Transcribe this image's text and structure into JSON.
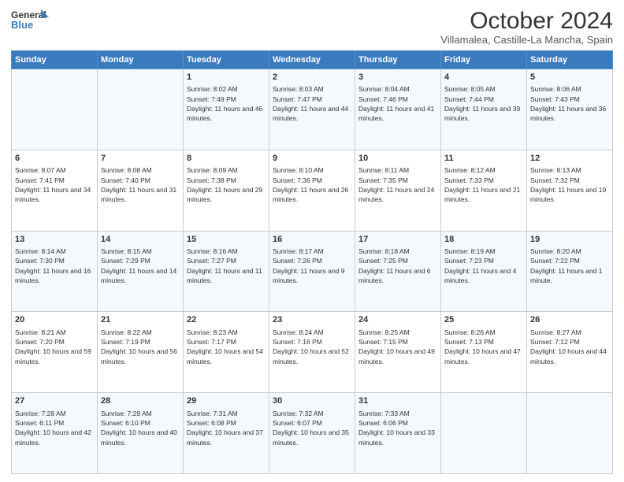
{
  "logo": {
    "line1": "General",
    "line2": "Blue"
  },
  "title": "October 2024",
  "subtitle": "Villamalea, Castille-La Mancha, Spain",
  "headers": [
    "Sunday",
    "Monday",
    "Tuesday",
    "Wednesday",
    "Thursday",
    "Friday",
    "Saturday"
  ],
  "weeks": [
    [
      {
        "day": "",
        "sunrise": "",
        "sunset": "",
        "daylight": ""
      },
      {
        "day": "",
        "sunrise": "",
        "sunset": "",
        "daylight": ""
      },
      {
        "day": "1",
        "sunrise": "Sunrise: 8:02 AM",
        "sunset": "Sunset: 7:49 PM",
        "daylight": "Daylight: 11 hours and 46 minutes."
      },
      {
        "day": "2",
        "sunrise": "Sunrise: 8:03 AM",
        "sunset": "Sunset: 7:47 PM",
        "daylight": "Daylight: 11 hours and 44 minutes."
      },
      {
        "day": "3",
        "sunrise": "Sunrise: 8:04 AM",
        "sunset": "Sunset: 7:46 PM",
        "daylight": "Daylight: 11 hours and 41 minutes."
      },
      {
        "day": "4",
        "sunrise": "Sunrise: 8:05 AM",
        "sunset": "Sunset: 7:44 PM",
        "daylight": "Daylight: 11 hours and 39 minutes."
      },
      {
        "day": "5",
        "sunrise": "Sunrise: 8:06 AM",
        "sunset": "Sunset: 7:43 PM",
        "daylight": "Daylight: 11 hours and 36 minutes."
      }
    ],
    [
      {
        "day": "6",
        "sunrise": "Sunrise: 8:07 AM",
        "sunset": "Sunset: 7:41 PM",
        "daylight": "Daylight: 11 hours and 34 minutes."
      },
      {
        "day": "7",
        "sunrise": "Sunrise: 8:08 AM",
        "sunset": "Sunset: 7:40 PM",
        "daylight": "Daylight: 11 hours and 31 minutes."
      },
      {
        "day": "8",
        "sunrise": "Sunrise: 8:09 AM",
        "sunset": "Sunset: 7:38 PM",
        "daylight": "Daylight: 11 hours and 29 minutes."
      },
      {
        "day": "9",
        "sunrise": "Sunrise: 8:10 AM",
        "sunset": "Sunset: 7:36 PM",
        "daylight": "Daylight: 11 hours and 26 minutes."
      },
      {
        "day": "10",
        "sunrise": "Sunrise: 8:11 AM",
        "sunset": "Sunset: 7:35 PM",
        "daylight": "Daylight: 11 hours and 24 minutes."
      },
      {
        "day": "11",
        "sunrise": "Sunrise: 8:12 AM",
        "sunset": "Sunset: 7:33 PM",
        "daylight": "Daylight: 11 hours and 21 minutes."
      },
      {
        "day": "12",
        "sunrise": "Sunrise: 8:13 AM",
        "sunset": "Sunset: 7:32 PM",
        "daylight": "Daylight: 11 hours and 19 minutes."
      }
    ],
    [
      {
        "day": "13",
        "sunrise": "Sunrise: 8:14 AM",
        "sunset": "Sunset: 7:30 PM",
        "daylight": "Daylight: 11 hours and 16 minutes."
      },
      {
        "day": "14",
        "sunrise": "Sunrise: 8:15 AM",
        "sunset": "Sunset: 7:29 PM",
        "daylight": "Daylight: 11 hours and 14 minutes."
      },
      {
        "day": "15",
        "sunrise": "Sunrise: 8:16 AM",
        "sunset": "Sunset: 7:27 PM",
        "daylight": "Daylight: 11 hours and 11 minutes."
      },
      {
        "day": "16",
        "sunrise": "Sunrise: 8:17 AM",
        "sunset": "Sunset: 7:26 PM",
        "daylight": "Daylight: 11 hours and 9 minutes."
      },
      {
        "day": "17",
        "sunrise": "Sunrise: 8:18 AM",
        "sunset": "Sunset: 7:25 PM",
        "daylight": "Daylight: 11 hours and 6 minutes."
      },
      {
        "day": "18",
        "sunrise": "Sunrise: 8:19 AM",
        "sunset": "Sunset: 7:23 PM",
        "daylight": "Daylight: 11 hours and 4 minutes."
      },
      {
        "day": "19",
        "sunrise": "Sunrise: 8:20 AM",
        "sunset": "Sunset: 7:22 PM",
        "daylight": "Daylight: 11 hours and 1 minute."
      }
    ],
    [
      {
        "day": "20",
        "sunrise": "Sunrise: 8:21 AM",
        "sunset": "Sunset: 7:20 PM",
        "daylight": "Daylight: 10 hours and 59 minutes."
      },
      {
        "day": "21",
        "sunrise": "Sunrise: 8:22 AM",
        "sunset": "Sunset: 7:19 PM",
        "daylight": "Daylight: 10 hours and 56 minutes."
      },
      {
        "day": "22",
        "sunrise": "Sunrise: 8:23 AM",
        "sunset": "Sunset: 7:17 PM",
        "daylight": "Daylight: 10 hours and 54 minutes."
      },
      {
        "day": "23",
        "sunrise": "Sunrise: 8:24 AM",
        "sunset": "Sunset: 7:16 PM",
        "daylight": "Daylight: 10 hours and 52 minutes."
      },
      {
        "day": "24",
        "sunrise": "Sunrise: 8:25 AM",
        "sunset": "Sunset: 7:15 PM",
        "daylight": "Daylight: 10 hours and 49 minutes."
      },
      {
        "day": "25",
        "sunrise": "Sunrise: 8:26 AM",
        "sunset": "Sunset: 7:13 PM",
        "daylight": "Daylight: 10 hours and 47 minutes."
      },
      {
        "day": "26",
        "sunrise": "Sunrise: 8:27 AM",
        "sunset": "Sunset: 7:12 PM",
        "daylight": "Daylight: 10 hours and 44 minutes."
      }
    ],
    [
      {
        "day": "27",
        "sunrise": "Sunrise: 7:28 AM",
        "sunset": "Sunset: 6:11 PM",
        "daylight": "Daylight: 10 hours and 42 minutes."
      },
      {
        "day": "28",
        "sunrise": "Sunrise: 7:29 AM",
        "sunset": "Sunset: 6:10 PM",
        "daylight": "Daylight: 10 hours and 40 minutes."
      },
      {
        "day": "29",
        "sunrise": "Sunrise: 7:31 AM",
        "sunset": "Sunset: 6:08 PM",
        "daylight": "Daylight: 10 hours and 37 minutes."
      },
      {
        "day": "30",
        "sunrise": "Sunrise: 7:32 AM",
        "sunset": "Sunset: 6:07 PM",
        "daylight": "Daylight: 10 hours and 35 minutes."
      },
      {
        "day": "31",
        "sunrise": "Sunrise: 7:33 AM",
        "sunset": "Sunset: 6:06 PM",
        "daylight": "Daylight: 10 hours and 33 minutes."
      },
      {
        "day": "",
        "sunrise": "",
        "sunset": "",
        "daylight": ""
      },
      {
        "day": "",
        "sunrise": "",
        "sunset": "",
        "daylight": ""
      }
    ]
  ]
}
